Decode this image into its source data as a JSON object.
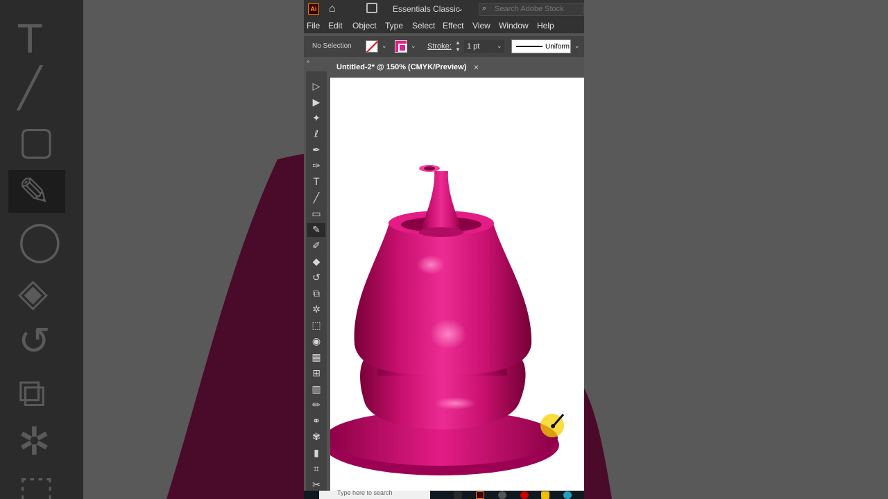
{
  "app": {
    "logo": "Ai",
    "workspace": "Essentials Classic",
    "search_placeholder": "Search Adobe Stock"
  },
  "menu": [
    "File",
    "Edit",
    "Object",
    "Type",
    "Select",
    "Effect",
    "View",
    "Window",
    "Help"
  ],
  "control_bar": {
    "selection": "No Selection",
    "stroke_label": "Stroke:",
    "stroke_weight": "1 pt",
    "profile": "Uniform"
  },
  "document": {
    "tab_title": "Untitled-2* @ 150% (CMYK/Preview)",
    "close": "×"
  },
  "colors": {
    "accent": "#e0208a",
    "object_fill": "#d8127a"
  },
  "tools": [
    "selection-tool",
    "direct-selection-tool",
    "magic-wand-tool",
    "lasso-tool",
    "pen-tool",
    "curvature-tool",
    "type-tool",
    "line-segment-tool",
    "rectangle-tool",
    "paintbrush-tool",
    "shaper-tool",
    "eraser-tool",
    "rotate-tool",
    "scale-tool",
    "puppet-warp-tool",
    "free-transform-tool",
    "shape-builder-tool",
    "perspective-grid-tool",
    "mesh-tool",
    "gradient-tool",
    "eyedropper-tool",
    "blend-tool",
    "symbol-sprayer-tool",
    "column-graph-tool",
    "artboard-tool",
    "slice-tool"
  ],
  "taskbar": {
    "search_placeholder": "Type here to search"
  }
}
